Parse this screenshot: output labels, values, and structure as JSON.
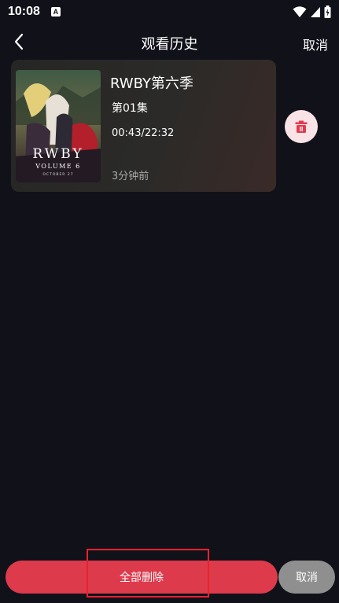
{
  "status_bar": {
    "time": "10:08",
    "app_icon_letter": "A",
    "icons": [
      "wifi-icon",
      "signal-icon",
      "battery-icon"
    ]
  },
  "header": {
    "back_icon": "chevron-left-icon",
    "title": "观看历史",
    "cancel_label": "取消"
  },
  "history": {
    "items": [
      {
        "title": "RWBY第六季",
        "episode": "第01集",
        "progress": "00:43/22:32",
        "watched_ago": "3分钟前",
        "poster_text": "RWBY",
        "poster_subtext": "VOLUME 6",
        "poster_tagline": "OCTOBER 27",
        "delete_icon": "trash-icon"
      }
    ]
  },
  "bottom_bar": {
    "delete_all_label": "全部删除",
    "cancel_label": "取消"
  },
  "colors": {
    "background": "#11111a",
    "accent_red": "#dd3a4c",
    "delete_bg": "#f9e3e6",
    "cancel_gray": "#8f8f8f",
    "highlight": "#e8222e"
  }
}
